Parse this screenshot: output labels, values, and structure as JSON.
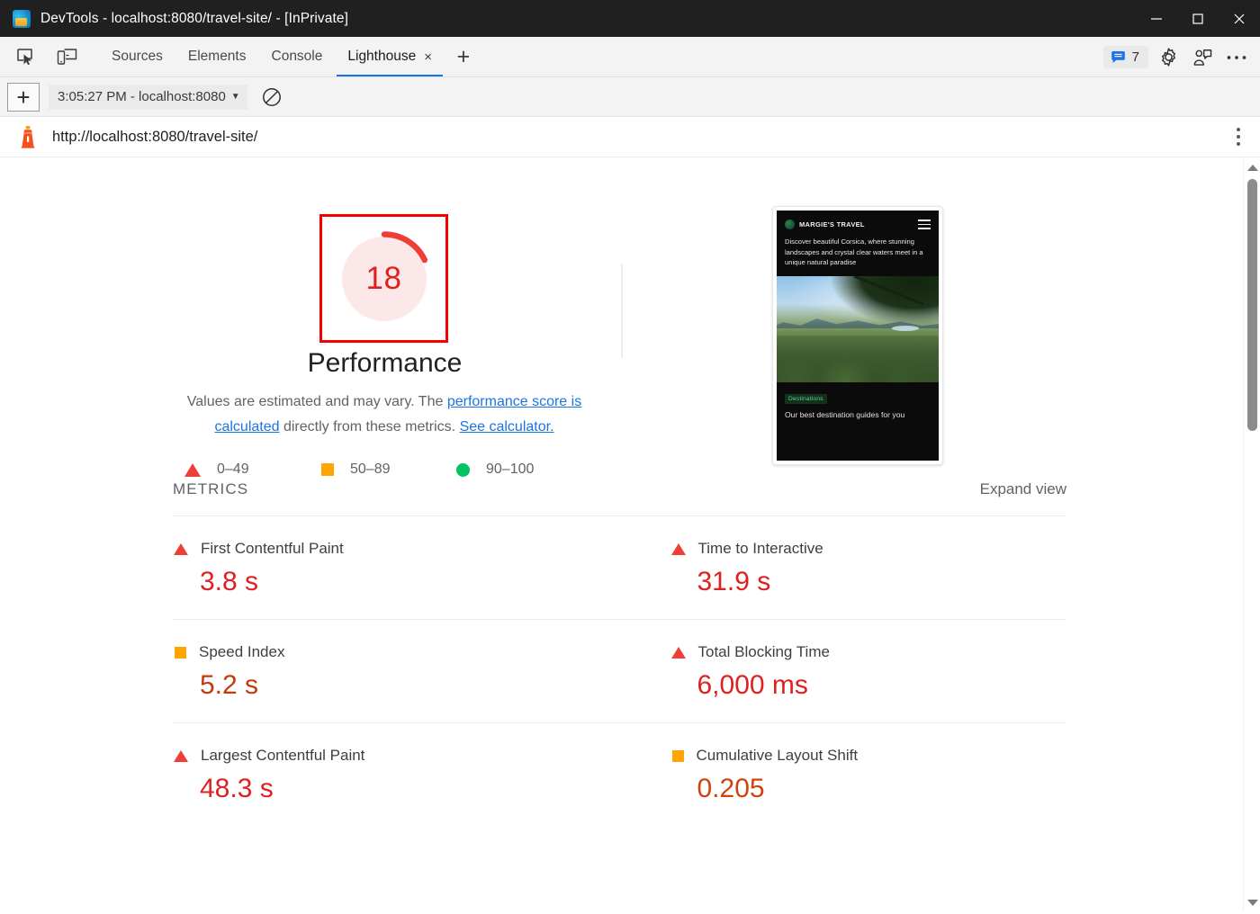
{
  "window": {
    "title": "DevTools - localhost:8080/travel-site/ - [InPrivate]",
    "app_icon": "edge-devtools-icon",
    "controls": {
      "minimize": "minimize-icon",
      "maximize": "maximize-icon",
      "close": "close-icon"
    }
  },
  "devtools": {
    "tool_icons": [
      {
        "name": "inspect-element-icon"
      },
      {
        "name": "device-toolbar-icon"
      }
    ],
    "tabs": [
      {
        "label": "Sources",
        "active": false
      },
      {
        "label": "Elements",
        "active": false
      },
      {
        "label": "Console",
        "active": false
      },
      {
        "label": "Lighthouse",
        "active": true
      }
    ],
    "tab_close": "×",
    "new_tab": "+",
    "issues_badge": {
      "icon": "message-icon",
      "count": "7"
    },
    "right_icons": [
      {
        "name": "gear-icon"
      },
      {
        "name": "feedback-icon"
      },
      {
        "name": "more-options-icon"
      }
    ]
  },
  "lighthouse_toolbar": {
    "new_report_label": "+",
    "report_select": "3:05:27 PM - localhost:8080",
    "caret": "▼",
    "clear_icon": "clear-icon"
  },
  "url_row": {
    "favicon": "lighthouse-icon",
    "url": "http://localhost:8080/travel-site/",
    "menu_icon": "vertical-dots-icon"
  },
  "report": {
    "category": {
      "title": "Performance",
      "score": "18",
      "score_color": "#e02020",
      "gauge_fill": "#fce8e8",
      "gauge_arc": "#ef3e36",
      "gauge_percent": 18,
      "highlight_color": "#f50000"
    },
    "description": {
      "part1": "Values are estimated and may vary. The ",
      "link1": "performance score is calculated",
      "part2": " directly from these metrics. ",
      "link2": "See calculator."
    },
    "legend": [
      {
        "shape": "triangle",
        "color": "#ef3e36",
        "label": "0–49"
      },
      {
        "shape": "square",
        "color": "#ffa400",
        "label": "50–89"
      },
      {
        "shape": "circle",
        "color": "#00c462",
        "label": "90–100"
      }
    ],
    "thumbnail": {
      "brand": "MARGIE'S TRAVEL",
      "brand_icon": "globe-icon",
      "menu_icon": "hamburger-icon",
      "hero": "Discover beautiful Corsica, where stunning landscapes and crystal clear waters meet in a unique natural paradise",
      "photo": "corsica-landscape-photo",
      "tag": "Destinations",
      "subheading": "Our best destination guides for you"
    },
    "metrics_section": {
      "title": "METRICS",
      "expand_view": "Expand view",
      "items": [
        {
          "column": "left",
          "shape": "triangle",
          "color": "#ef3e36",
          "name": "First Contentful Paint",
          "value": "3.8 s",
          "value_color": "#e02020"
        },
        {
          "column": "right",
          "shape": "triangle",
          "color": "#ef3e36",
          "name": "Time to Interactive",
          "value": "31.9 s",
          "value_color": "#e02020"
        },
        {
          "column": "left",
          "shape": "square",
          "color": "#ffa400",
          "name": "Speed Index",
          "value": "5.2 s",
          "value_color": "#c5390a"
        },
        {
          "column": "right",
          "shape": "triangle",
          "color": "#ef3e36",
          "name": "Total Blocking Time",
          "value": "6,000 ms",
          "value_color": "#e02020"
        },
        {
          "column": "left",
          "shape": "triangle",
          "color": "#ef3e36",
          "name": "Largest Contentful Paint",
          "value": "48.3 s",
          "value_color": "#e02020"
        },
        {
          "column": "right",
          "shape": "square",
          "color": "#ffa400",
          "name": "Cumulative Layout Shift",
          "value": "0.205",
          "value_color": "#d1430b"
        }
      ]
    }
  },
  "scrollbar": {
    "up_arrow": "scroll-up-arrow",
    "down_arrow": "scroll-down-arrow",
    "thumb": "scroll-thumb"
  }
}
